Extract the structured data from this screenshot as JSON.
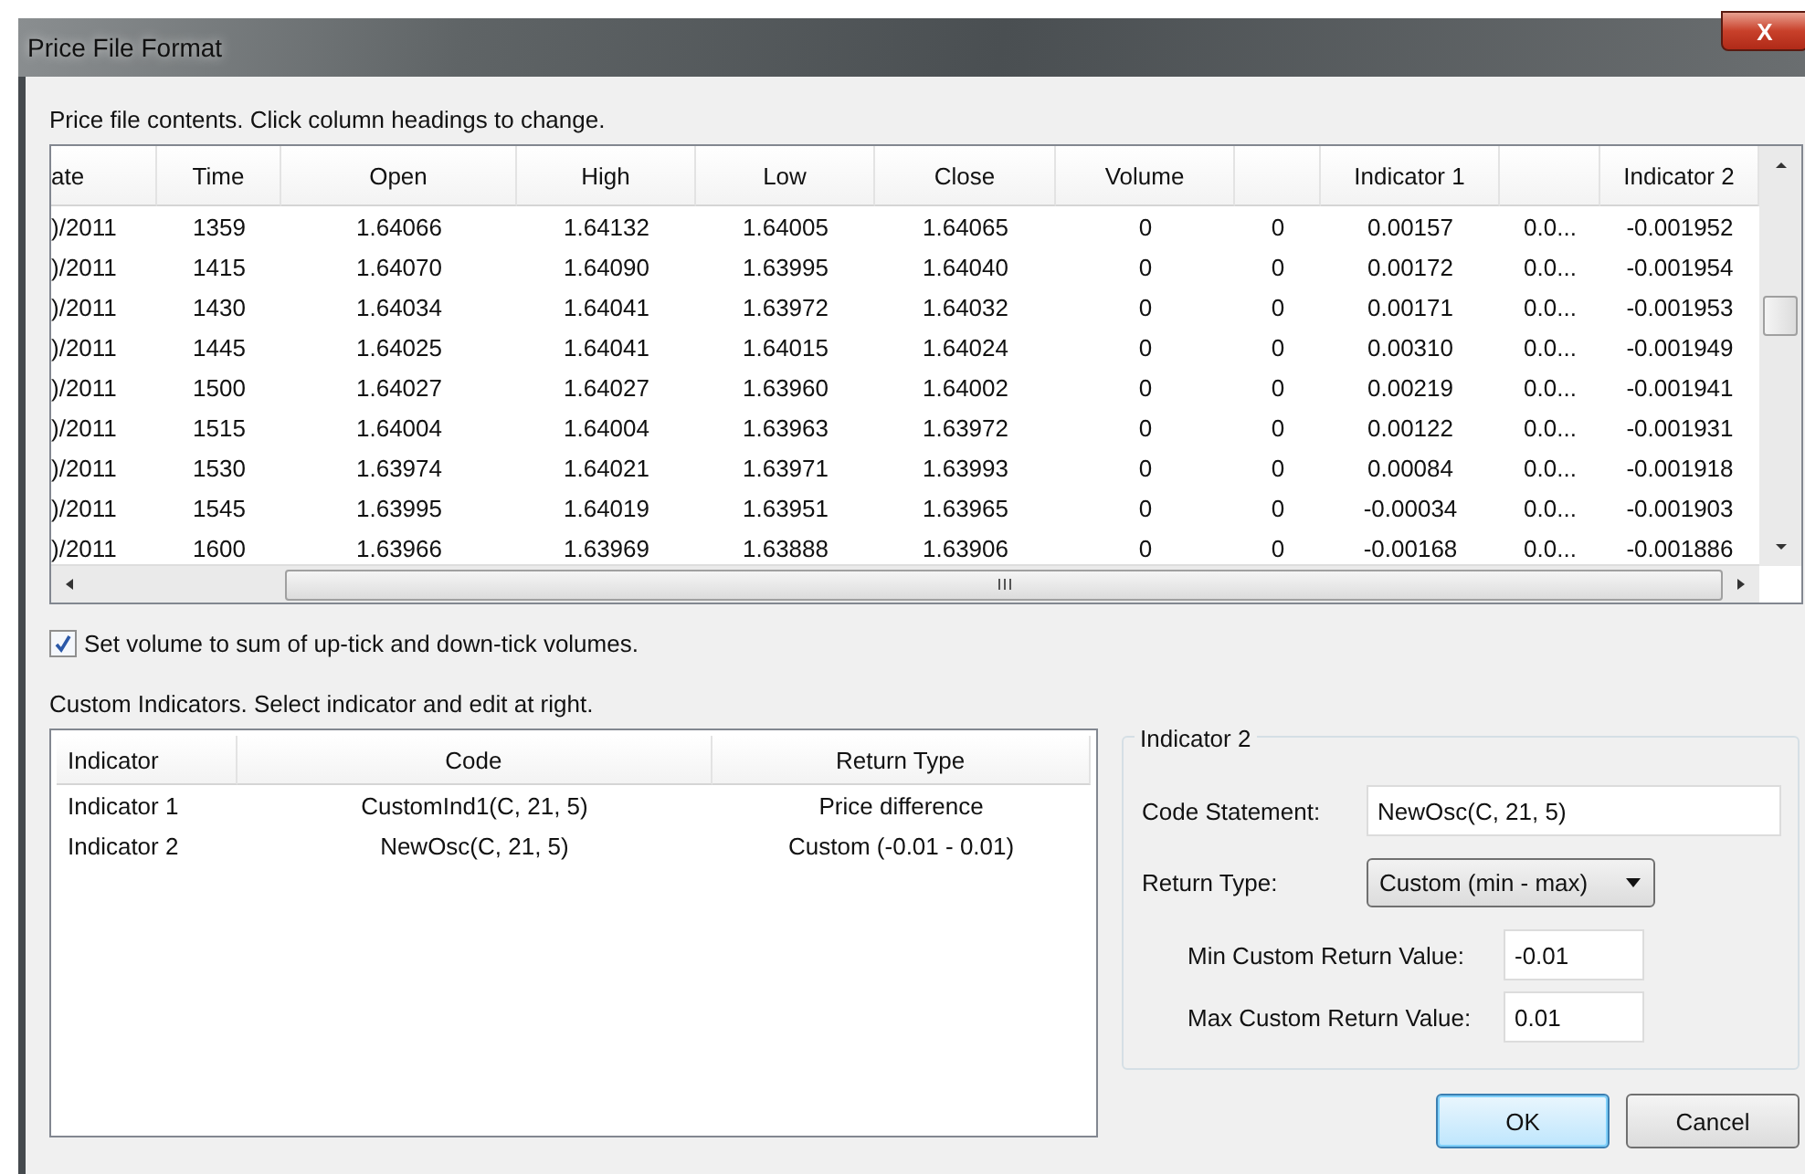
{
  "window": {
    "title": "Price File Format",
    "close": "X"
  },
  "price_file": {
    "caption": "Price file contents. Click column headings to change.",
    "columns": [
      {
        "label": "ate"
      },
      {
        "label": "Time"
      },
      {
        "label": "Open"
      },
      {
        "label": "High"
      },
      {
        "label": "Low"
      },
      {
        "label": "Close"
      },
      {
        "label": "Volume"
      },
      {},
      {
        "label": "Indicator 1"
      },
      {},
      {
        "label": "Indicator 2"
      }
    ],
    "rows": [
      [
        ")/2011",
        "1359",
        "1.64066",
        "1.64132",
        "1.64005",
        "1.64065",
        "0",
        "0",
        "0.00157",
        "0.0...",
        "-0.001952"
      ],
      [
        ")/2011",
        "1415",
        "1.64070",
        "1.64090",
        "1.63995",
        "1.64040",
        "0",
        "0",
        "0.00172",
        "0.0...",
        "-0.001954"
      ],
      [
        ")/2011",
        "1430",
        "1.64034",
        "1.64041",
        "1.63972",
        "1.64032",
        "0",
        "0",
        "0.00171",
        "0.0...",
        "-0.001953"
      ],
      [
        ")/2011",
        "1445",
        "1.64025",
        "1.64041",
        "1.64015",
        "1.64024",
        "0",
        "0",
        "0.00310",
        "0.0...",
        "-0.001949"
      ],
      [
        ")/2011",
        "1500",
        "1.64027",
        "1.64027",
        "1.63960",
        "1.64002",
        "0",
        "0",
        "0.00219",
        "0.0...",
        "-0.001941"
      ],
      [
        ")/2011",
        "1515",
        "1.64004",
        "1.64004",
        "1.63963",
        "1.63972",
        "0",
        "0",
        "0.00122",
        "0.0...",
        "-0.001931"
      ],
      [
        ")/2011",
        "1530",
        "1.63974",
        "1.64021",
        "1.63971",
        "1.63993",
        "0",
        "0",
        "0.00084",
        "0.0...",
        "-0.001918"
      ],
      [
        ")/2011",
        "1545",
        "1.63995",
        "1.64019",
        "1.63951",
        "1.63965",
        "0",
        "0",
        "-0.00034",
        "0.0...",
        "-0.001903"
      ],
      [
        ")/2011",
        "1600",
        "1.63966",
        "1.63969",
        "1.63888",
        "1.63906",
        "0",
        "0",
        "-0.00168",
        "0.0...",
        "-0.001886"
      ]
    ]
  },
  "volume_option": {
    "label": "Set volume to sum of up-tick and down-tick volumes.",
    "checked": true
  },
  "custom_indicators": {
    "caption": "Custom Indicators. Select indicator and edit at right.",
    "columns": [
      "Indicator",
      "Code",
      "Return Type"
    ],
    "rows": [
      [
        "Indicator 1",
        "CustomInd1(C, 21, 5)",
        "Price difference"
      ],
      [
        "Indicator 2",
        "NewOsc(C, 21, 5)",
        "Custom (-0.01 - 0.01)"
      ]
    ]
  },
  "editor": {
    "title": "Indicator 2",
    "code_label": "Code Statement:",
    "code_value": "NewOsc(C, 21, 5)",
    "return_label": "Return Type:",
    "return_value": "Custom (min - max)",
    "min_label": "Min Custom Return Value:",
    "min_value": "-0.01",
    "max_label": "Max Custom Return Value:",
    "max_value": "0.01"
  },
  "buttons": [
    {
      "label": "OK",
      "default": true
    },
    {
      "label": "Cancel",
      "default": false
    }
  ]
}
